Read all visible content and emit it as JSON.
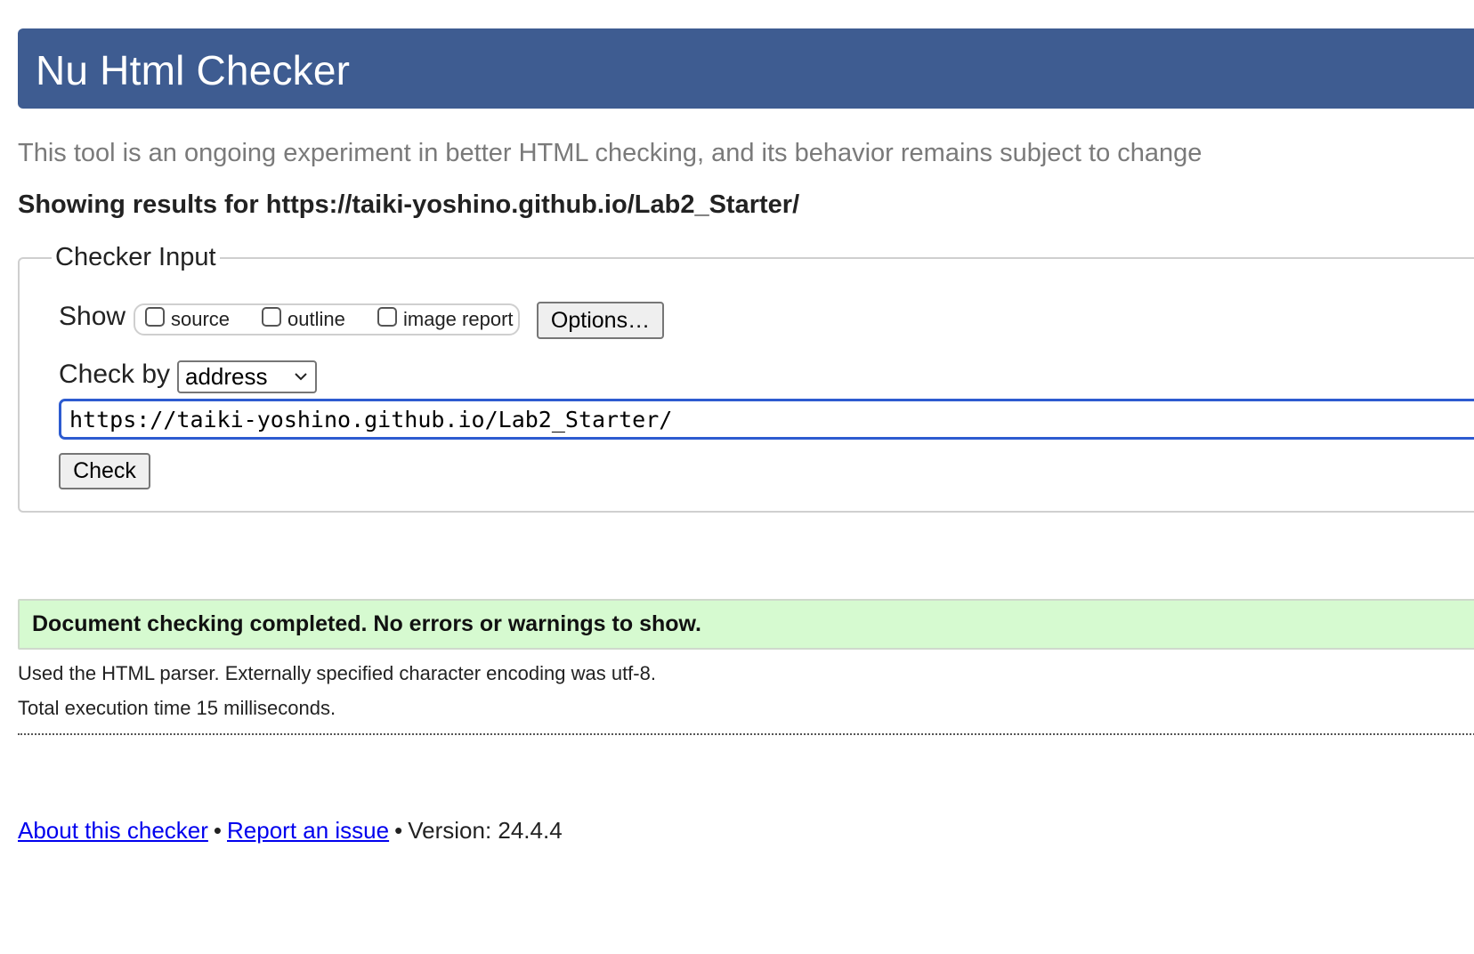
{
  "header": {
    "title": "Nu Html Checker",
    "color": "#3e5c91"
  },
  "subtitle": "This tool is an ongoing experiment in better HTML checking, and its behavior remains subject to change",
  "results_heading": {
    "prefix": "Showing results for ",
    "url": "https://taiki-yoshino.github.io/Lab2_Starter/"
  },
  "checker_input": {
    "legend": "Checker Input",
    "show_label": "Show",
    "show_options": [
      {
        "label": "source",
        "checked": false
      },
      {
        "label": "outline",
        "checked": false
      },
      {
        "label": "image report",
        "checked": false
      }
    ],
    "options_button": "Options…",
    "check_by_label": "Check by",
    "check_by_value": "address",
    "url_value": "https://taiki-yoshino.github.io/Lab2_Starter/",
    "check_button": "Check"
  },
  "result": {
    "message": "Document checking completed. No errors or warnings to show.",
    "color": "#d6fad0",
    "parser_info": "Used the HTML parser. Externally specified character encoding was utf-8.",
    "execution_time": "Total execution time 15 milliseconds."
  },
  "footer": {
    "about_link": "About this checker",
    "separator": "•",
    "report_link": "Report an issue",
    "version": "Version: 24.4.4"
  }
}
